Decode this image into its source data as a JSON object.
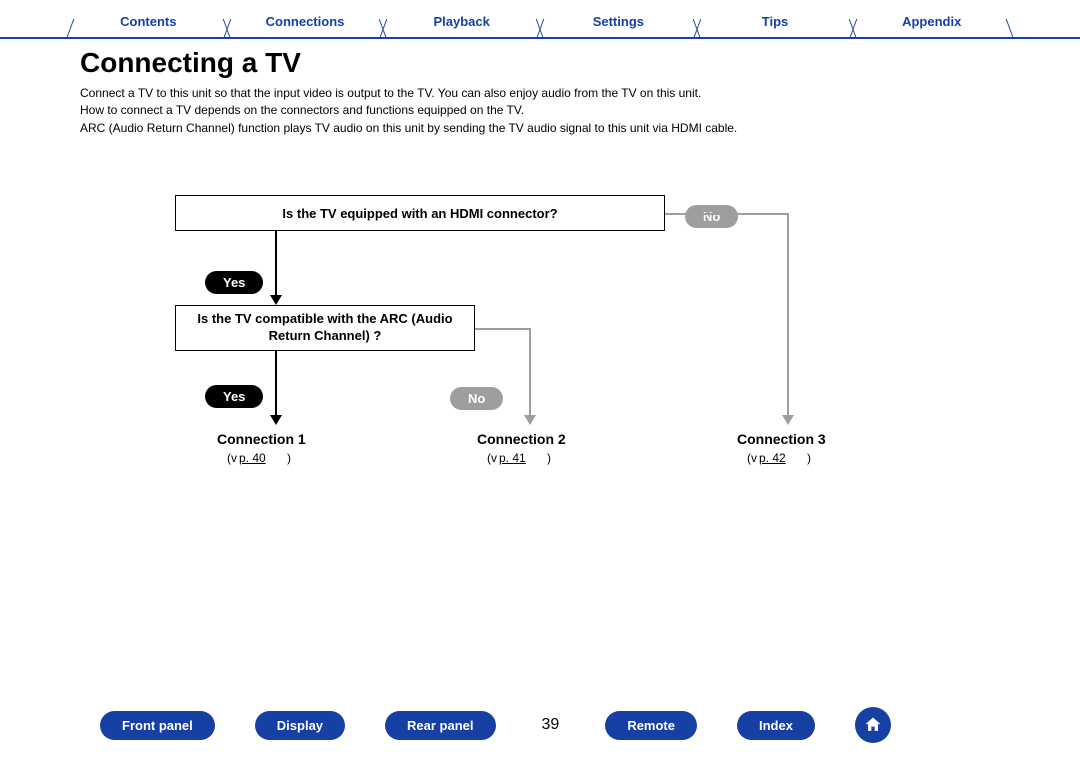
{
  "topTabs": [
    "Contents",
    "Connections",
    "Playback",
    "Settings",
    "Tips",
    "Appendix"
  ],
  "title": "Connecting a TV",
  "intro": {
    "l1": "Connect a TV to this unit so that the input video is output to the TV. You can also enjoy audio from the TV on this unit.",
    "l2": "How to connect a TV depends on the connectors and functions equipped on the TV.",
    "l3": "ARC (Audio Return Channel) function plays TV audio on this unit by sending the TV audio signal to this unit via HDMI cable."
  },
  "chart_data": {
    "type": "flowchart",
    "nodes": [
      {
        "id": "q1",
        "kind": "decision",
        "text": "Is the TV equipped with an HDMI connector?"
      },
      {
        "id": "q2",
        "kind": "decision",
        "text": "Is the TV compatible with the ARC (Audio Return Channel) ?"
      },
      {
        "id": "c1",
        "kind": "result",
        "label": "Connection 1",
        "page": "p. 40"
      },
      {
        "id": "c2",
        "kind": "result",
        "label": "Connection 2",
        "page": "p. 41"
      },
      {
        "id": "c3",
        "kind": "result",
        "label": "Connection 3",
        "page": "p. 42"
      }
    ],
    "edges": [
      {
        "from": "q1",
        "to": "q2",
        "label": "Yes"
      },
      {
        "from": "q1",
        "to": "c3",
        "label": "No"
      },
      {
        "from": "q2",
        "to": "c1",
        "label": "Yes"
      },
      {
        "from": "q2",
        "to": "c2",
        "label": "No"
      }
    ]
  },
  "labels": {
    "yes": "Yes",
    "no": "No"
  },
  "pageNumber": "39",
  "bottomNav": [
    "Front panel",
    "Display",
    "Rear panel",
    "Remote",
    "Index"
  ]
}
